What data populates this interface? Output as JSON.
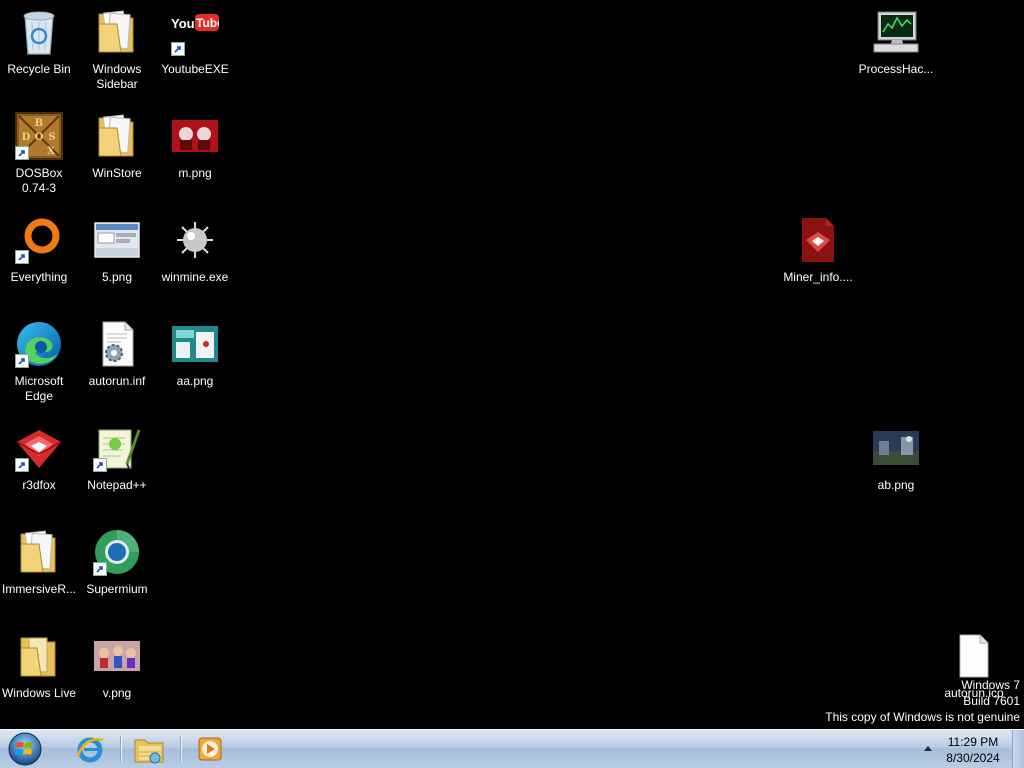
{
  "desktop": {
    "icons": [
      {
        "label": "Recycle Bin",
        "icon": "recycle-bin-icon",
        "shortcut": false
      },
      {
        "label": "Windows\nSidebar",
        "icon": "folder-icon",
        "shortcut": false
      },
      {
        "label": "YoutubeEXE",
        "icon": "youtube-icon",
        "shortcut": true
      },
      {
        "label": "ProcessHac...",
        "icon": "process-hacker-icon",
        "shortcut": false
      },
      {
        "label": "DOSBox\n0.74-3",
        "icon": "dosbox-icon",
        "shortcut": true
      },
      {
        "label": "WinStore",
        "icon": "folder-icon",
        "shortcut": false
      },
      {
        "label": "m.png",
        "icon": "image-thumbnail-icon",
        "shortcut": false
      },
      {
        "label": "Everything",
        "icon": "everything-icon",
        "shortcut": true
      },
      {
        "label": "5.png",
        "icon": "image-thumbnail-icon",
        "shortcut": false
      },
      {
        "label": "winmine.exe",
        "icon": "winmine-icon",
        "shortcut": false
      },
      {
        "label": "Miner_info....",
        "icon": "pdf-document-icon",
        "shortcut": false
      },
      {
        "label": "Microsoft\nEdge",
        "icon": "edge-icon",
        "shortcut": true
      },
      {
        "label": "autorun.inf",
        "icon": "settings-file-icon",
        "shortcut": false
      },
      {
        "label": "aa.png",
        "icon": "image-thumbnail-icon",
        "shortcut": false
      },
      {
        "label": "r3dfox",
        "icon": "r3dfox-icon",
        "shortcut": true
      },
      {
        "label": "Notepad++",
        "icon": "notepad-plus-plus-icon",
        "shortcut": true
      },
      {
        "label": "ab.png",
        "icon": "image-thumbnail-icon",
        "shortcut": false
      },
      {
        "label": "ImmersiveR...",
        "icon": "folder-icon",
        "shortcut": false
      },
      {
        "label": "Supermium",
        "icon": "supermium-icon",
        "shortcut": true
      },
      {
        "label": "Windows Live",
        "icon": "folder-icon",
        "shortcut": false
      },
      {
        "label": "v.png",
        "icon": "image-thumbnail-icon",
        "shortcut": false
      },
      {
        "label": "autorun.ico",
        "icon": "blank-file-icon",
        "shortcut": false
      }
    ]
  },
  "watermark": {
    "line1": "Windows 7",
    "line2": "Build 7601",
    "line3": "This copy of Windows is not genuine"
  },
  "taskbar": {
    "start": "start-orb-icon",
    "pinned": [
      "internet-explorer-icon",
      "windows-explorer-icon",
      "media-player-icon"
    ],
    "clock_time": "11:29 PM",
    "clock_date": "8/30/2024"
  },
  "colors": {
    "desktop_bg": "#000000",
    "taskbar_top": "#dfe9f5",
    "taskbar_bottom": "#a6bddb"
  }
}
